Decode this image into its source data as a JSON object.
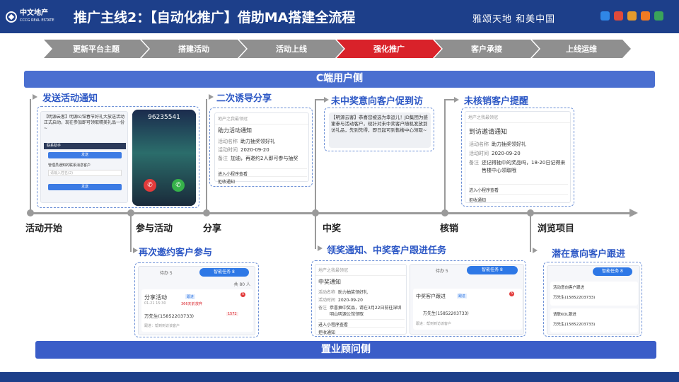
{
  "header": {
    "logo_name": "中文地产",
    "logo_sub": "CCCG REAL ESTATE",
    "title": "推广主线2：【自动化推广】借助MA搭建全流程",
    "slogan": "雅颂天地 和美中国",
    "app_icon_colors": [
      "#2f86e6",
      "#e04a3a",
      "#e39a2c",
      "#ef7a23",
      "#3aa35a"
    ]
  },
  "steps": [
    {
      "label": "更新平台主题",
      "active": false
    },
    {
      "label": "搭建活动",
      "active": false
    },
    {
      "label": "活动上线",
      "active": false
    },
    {
      "label": "强化推广",
      "active": true
    },
    {
      "label": "客户承接",
      "active": false
    },
    {
      "label": "上线运维",
      "active": false
    }
  ],
  "bands": {
    "customer": "C端用户侧",
    "business": "置业顾问侧"
  },
  "timeline_nodes": [
    "活动开始",
    "参与活动",
    "分享",
    "中奖",
    "核销",
    "浏览项目"
  ],
  "upper_annotations": [
    "发送活动通知",
    "二次诱导分享",
    "未中奖意向客户促到访",
    "未核销客户提醒"
  ],
  "lower_annotations": [
    "再次邀约客户参与",
    "领奖通知、中奖客户跟进任务",
    "潜在意向客户跟进"
  ],
  "sms1": {
    "text": "【明源云客】明源公馆春节好礼大放送活动正式启动，现在参加即可领取精美礼品一份~",
    "phone_number": "96235541",
    "wechat_title": "联系助手",
    "btn1": "发送",
    "form_label": "管理员通知的联系消息客户",
    "input_placeholder": "请输入姓名(2)",
    "btn2": "发送"
  },
  "share_card": {
    "app": "地产之我最领冠",
    "title": "助力活动通知",
    "f1k": "活动名称",
    "f1v": "助力抽奖领好礼",
    "f2k": "活动时间",
    "f2v": "2020-09-20",
    "f3k": "备注",
    "f3v": "加油，再邀约2人即可参与抽奖",
    "link1": "进入小程序查看",
    "link2": "拒收通知"
  },
  "sms2": {
    "text": "【明源云客】恭喜您被选为幸运儿！JD集团为感谢参与活动客户，现针对未中奖客户随机发放到访礼品，先到先得，即日起可到售楼中心领取~"
  },
  "redeem_card": {
    "app": "地产之我最领冠",
    "title": "到访邀请通知",
    "f1k": "活动名称",
    "f1v": "助力抽奖领好礼",
    "f2k": "活动时间",
    "f2v": "2020-09-20",
    "f3k": "备注",
    "f3v": "还记得抽中的奖品吗，18-20日记得来售楼中心领取哦",
    "link1": "进入小程序查看",
    "link2": "拒收通知"
  },
  "task_card1": {
    "tab1": "待办 5",
    "tab2": "智能任务 8",
    "count": "共 80 人",
    "item": "分享活动",
    "tag": "跟进",
    "badge": "5",
    "date": "01-21 15:30",
    "stat1": "366天前",
    "stat2": "放弃",
    "customer": "万先生(15852203733)",
    "phone_mask": "1572",
    "footer": "跟进：帮到到访该客户"
  },
  "award_card": {
    "app": "地产之我最领冠",
    "title": "中奖通知",
    "f1k": "活动名称",
    "f1v": "助力抽奖领好礼",
    "f2k": "活动时间",
    "f2v": "2020-09-20",
    "f3k": "备注",
    "f3v": "恭喜抽中奖品，请在3月22日前往深圳明山明源公馆领取",
    "link1": "进入小程序查看",
    "link2": "拒收通知"
  },
  "task_card2": {
    "tab1": "待办 5",
    "tab2": "智能任务 8",
    "item": "中奖客户跟进",
    "tag": "跟进",
    "badge": "5",
    "customer": "万先生(15852203733)",
    "footer": "跟进：帮到到访该客户"
  },
  "task_card3": {
    "tab": "智能任务 8",
    "item1": "活动意向客户跟进",
    "customer1": "万先生(15852203733)",
    "item2": "请联KOL跟进",
    "customer2": "万先生(15852203733)"
  }
}
